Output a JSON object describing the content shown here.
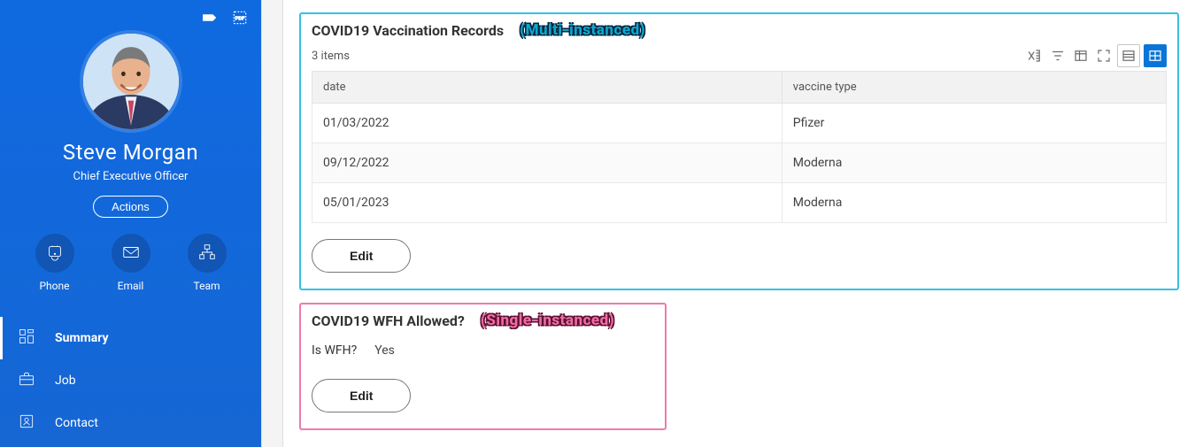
{
  "sidebar": {
    "employee_name": "Steve Morgan",
    "employee_title": "Chief Executive Officer",
    "actions_label": "Actions",
    "contacts": {
      "phone": "Phone",
      "email": "Email",
      "team": "Team"
    },
    "nav": [
      {
        "label": "Summary",
        "selected": true
      },
      {
        "label": "Job",
        "selected": false
      },
      {
        "label": "Contact",
        "selected": false
      }
    ]
  },
  "vaccination_panel": {
    "title": "COVID19 Vaccination Records",
    "annotation": "(Multi-instanced)",
    "items_text": "3 items",
    "columns": {
      "date": "date",
      "vaccine_type": "vaccine type"
    },
    "rows": [
      {
        "date": "01/03/2022",
        "type": "Pfizer"
      },
      {
        "date": "09/12/2022",
        "type": "Moderna"
      },
      {
        "date": "05/01/2023",
        "type": "Moderna"
      }
    ],
    "edit_label": "Edit"
  },
  "wfh_panel": {
    "title": "COVID19 WFH Allowed?",
    "annotation": "(Single-instanced)",
    "field_label": "Is WFH?",
    "field_value": "Yes",
    "edit_label": "Edit"
  }
}
